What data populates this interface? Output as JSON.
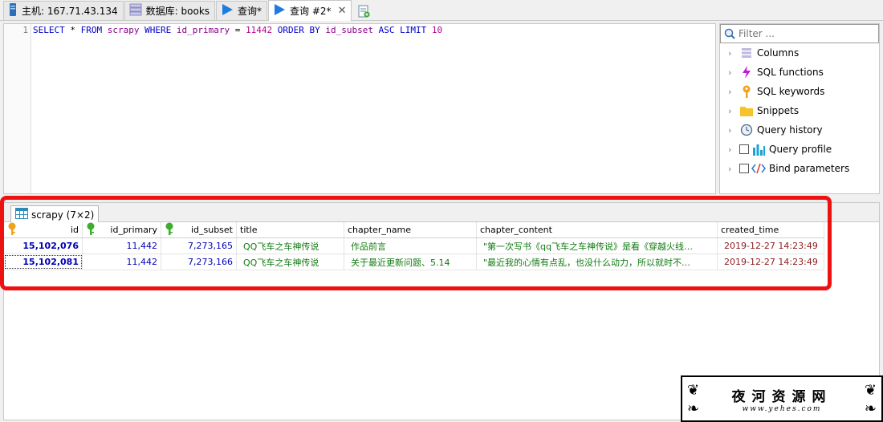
{
  "tabs": [
    {
      "label": "主机: 167.71.43.134",
      "icon": "server-icon"
    },
    {
      "label": "数据库: books",
      "icon": "database-icon"
    },
    {
      "label": "查询*",
      "icon": "query-icon"
    },
    {
      "label": "查询 #2*",
      "icon": "query-icon",
      "active": true
    }
  ],
  "editor": {
    "line_number": "1",
    "tokens": {
      "select": "SELECT",
      "star": "*",
      "from": "FROM",
      "table": "scrapy",
      "where": "WHERE",
      "col1": "id_primary",
      "eq": "=",
      "val": "11442",
      "order": "ORDER BY",
      "col2": "id_subset",
      "asc": "ASC",
      "limit": "LIMIT",
      "limitval": "10"
    }
  },
  "helper": {
    "filter_placeholder": "Filter ...",
    "items": [
      {
        "label": "Columns",
        "icon": "columns-icon"
      },
      {
        "label": "SQL functions",
        "icon": "lightning-icon"
      },
      {
        "label": "SQL keywords",
        "icon": "key-icon"
      },
      {
        "label": "Snippets",
        "icon": "folder-icon"
      },
      {
        "label": "Query history",
        "icon": "history-icon"
      },
      {
        "label": "Query profile",
        "icon": "profile-chart-icon"
      },
      {
        "label": "Bind parameters",
        "icon": "code-icon"
      }
    ]
  },
  "result": {
    "tab_label": "scrapy (7×2)",
    "columns": [
      "id",
      "id_primary",
      "id_subset",
      "title",
      "chapter_name",
      "chapter_content",
      "created_time"
    ],
    "rows": [
      [
        "15,102,076",
        "11,442",
        "7,273,165",
        "QQ飞车之车神传说",
        "作品前言",
        "\"第一次写书《qq飞车之车神传说》是看《穿越火线…",
        "2019-12-27 14:23:49"
      ],
      [
        "15,102,081",
        "11,442",
        "7,273,166",
        "QQ飞车之车神传说",
        "关于最近更新问题、5.14",
        "\"最近我的心情有点乱，也没什么动力，所以就时不…",
        "2019-12-27 14:23:49"
      ]
    ]
  },
  "watermark": {
    "title": "夜河资源网",
    "url": "www.yehes.com"
  },
  "colors": {
    "keyword": "#0000c8",
    "annotation": "#ee1111"
  }
}
